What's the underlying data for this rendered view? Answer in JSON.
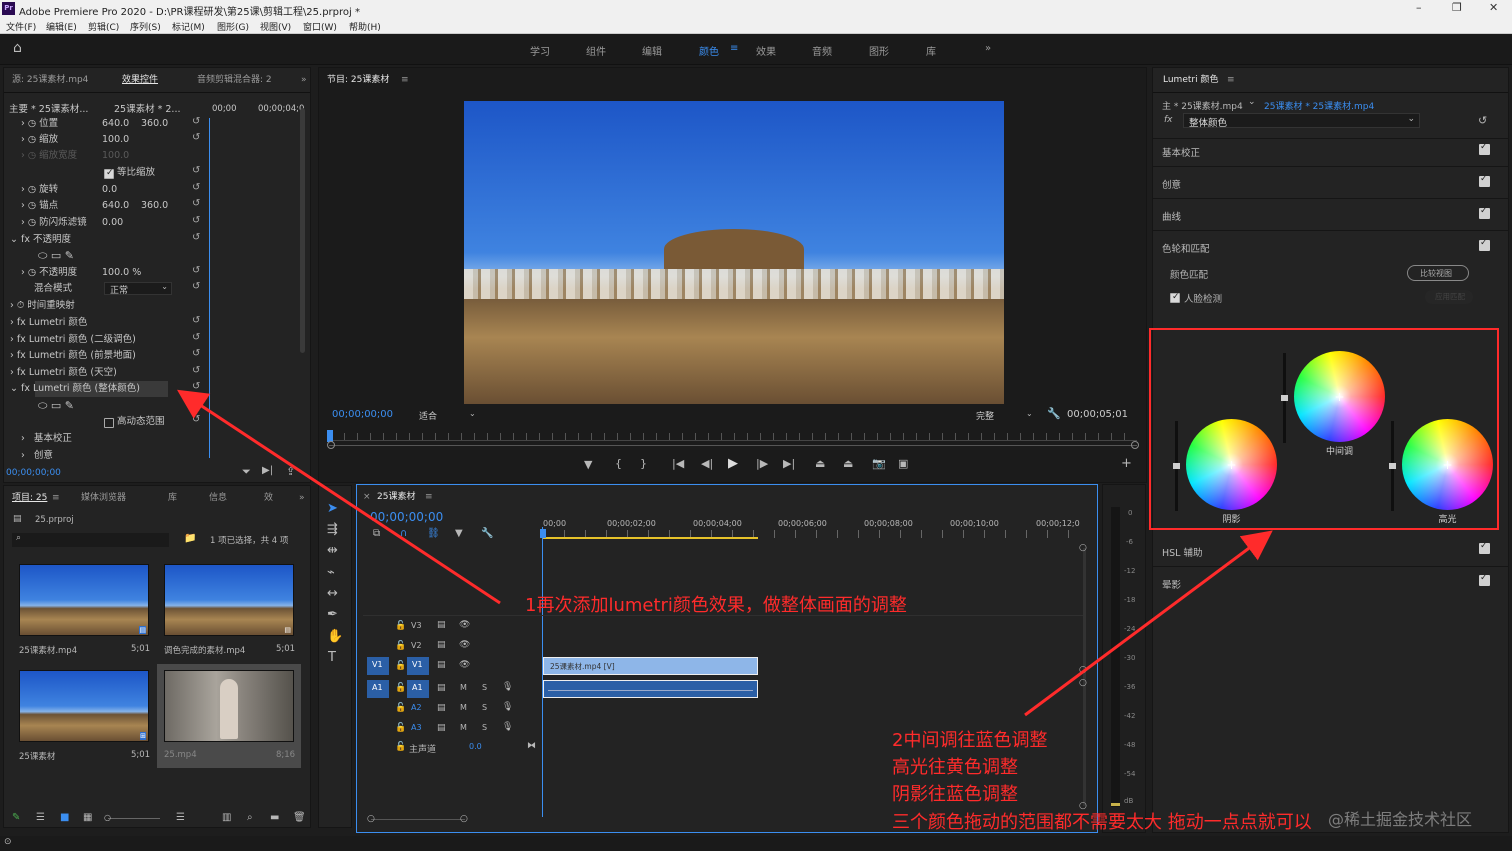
{
  "window": {
    "app_icon": "Pr",
    "title": "Adobe Premiere Pro 2020 - D:\\PR课程研发\\第25课\\剪辑工程\\25.prproj *"
  },
  "menu": [
    "文件(F)",
    "编辑(E)",
    "剪辑(C)",
    "序列(S)",
    "标记(M)",
    "图形(G)",
    "视图(V)",
    "窗口(W)",
    "帮助(H)"
  ],
  "workspaces": [
    "学习",
    "组件",
    "编辑",
    "颜色",
    "效果",
    "音频",
    "图形",
    "库"
  ],
  "workspace_more": "»",
  "effect_controls": {
    "tabs": [
      "源: 25课素材.mp4",
      "效果控件",
      "音频剪辑混合器: 2"
    ],
    "master": "主要 * 25课素材...",
    "clip": "25课素材 * 2...",
    "time0": "00;00",
    "time1": "00;00;04;0",
    "rows": [
      {
        "label": "位置",
        "v1": "640.0",
        "v2": "360.0"
      },
      {
        "label": "缩放",
        "v1": "100.0"
      },
      {
        "label": "缩放宽度",
        "v1": "100.0"
      },
      {
        "label": "等比缩放"
      },
      {
        "label": "旋转",
        "v1": "0.0"
      },
      {
        "label": "锚点",
        "v1": "640.0",
        "v2": "360.0"
      },
      {
        "label": "防闪烁滤镜",
        "v1": "0.00"
      },
      {
        "label": "不透明度"
      },
      {
        "label": "不透明度",
        "v1": "100.0 %"
      },
      {
        "label": "混合模式",
        "v1": "正常"
      },
      {
        "label": "时间重映射"
      },
      {
        "label": "Lumetri 颜色"
      },
      {
        "label": "Lumetri 颜色 (二级调色)"
      },
      {
        "label": "Lumetri 颜色 (前景地面)"
      },
      {
        "label": "Lumetri 颜色 (天空)"
      },
      {
        "label": "Lumetri 颜色 (整体颜色)"
      },
      {
        "label": "高动态范围"
      },
      {
        "label": "基本校正"
      },
      {
        "label": "创意"
      }
    ],
    "timecode": "00;00;00;00"
  },
  "program": {
    "title": "节目: 25课素材",
    "timecode": "00;00;00;00",
    "fit": "适合",
    "quality": "完整",
    "duration": "00;00;05;01"
  },
  "project": {
    "tabs": [
      "项目: 25",
      "媒体浏览器",
      "库",
      "信息",
      "效"
    ],
    "file": "25.prproj",
    "selection": "1 项已选择，共 4 项",
    "items": [
      {
        "name": "25课素材.mp4",
        "dur": "5;01"
      },
      {
        "name": "调色完成的素材.mp4",
        "dur": "5;01"
      },
      {
        "name": "25课素材",
        "dur": "5;01"
      },
      {
        "name": "25.mp4",
        "dur": "8;16"
      }
    ]
  },
  "timeline": {
    "title": "25课素材",
    "timecode": "00;00;00;00",
    "ruler": [
      "00;00",
      "00;00;02;00",
      "00;00;04;00",
      "00;00;06;00",
      "00;00;08;00",
      "00;00;10;00",
      "00;00;12;0"
    ],
    "tracks": [
      "V3",
      "V2",
      "V1",
      "A1",
      "A2",
      "A3"
    ],
    "master": "主声道",
    "master_val": "0.0",
    "clip_v": "25课素材.mp4 [V]"
  },
  "lumetri": {
    "title": "Lumetri 颜色",
    "master": "主 * 25课素材.mp4",
    "clip": "25课素材 * 25课素材.mp4",
    "preset": "整体颜色",
    "sections": [
      "基本校正",
      "创意",
      "曲线",
      "色轮和匹配"
    ],
    "color_match": "颜色匹配",
    "compare": "比较视图",
    "face_detect": "人脸检测",
    "apply_match": "应用匹配",
    "wheels": [
      "阴影",
      "中间调",
      "高光"
    ],
    "bottom_sections": [
      "HSL 辅助",
      "晕影"
    ]
  },
  "audio_meter": [
    "0",
    "-6",
    "-12",
    "-18",
    "-24",
    "-30",
    "-36",
    "-42",
    "-48",
    "-54",
    "dB"
  ],
  "annotations": {
    "a1": "1再次添加lumetri颜色效果，做整体画面的调整",
    "a2": [
      "2中间调往蓝色调整",
      "高光往黄色调整",
      "阴影往蓝色调整",
      "三个颜色拖动的范围都不需要太大  拖动一点点就可以"
    ]
  },
  "watermark": "@稀土掘金技术社区"
}
